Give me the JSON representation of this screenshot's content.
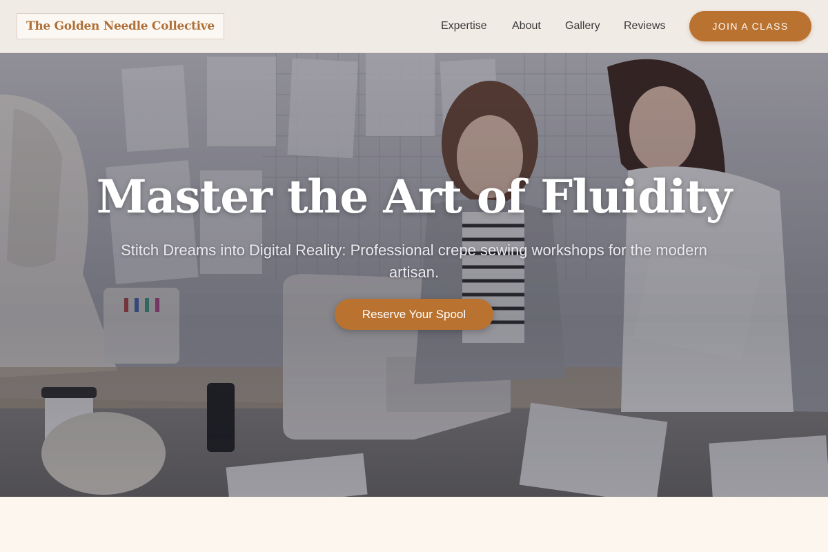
{
  "brand": {
    "name": "The Golden Needle Collective"
  },
  "nav": {
    "items": [
      {
        "label": "Expertise"
      },
      {
        "label": "About"
      },
      {
        "label": "Gallery"
      },
      {
        "label": "Reviews"
      }
    ],
    "cta_label": "JOIN A CLASS"
  },
  "hero": {
    "title": "Master the Art of Fluidity",
    "subtitle": "Stitch Dreams into Digital Reality: Professional crepe sewing workshops for the modern artisan.",
    "button_label": "Reserve Your Spool",
    "image_description_icon": "sewing-workshop-photo"
  },
  "colors": {
    "accent": "#b9722f",
    "brand_text": "#b06f36",
    "header_bg": "#f1ebe5",
    "page_bg": "#fdf6ee"
  }
}
